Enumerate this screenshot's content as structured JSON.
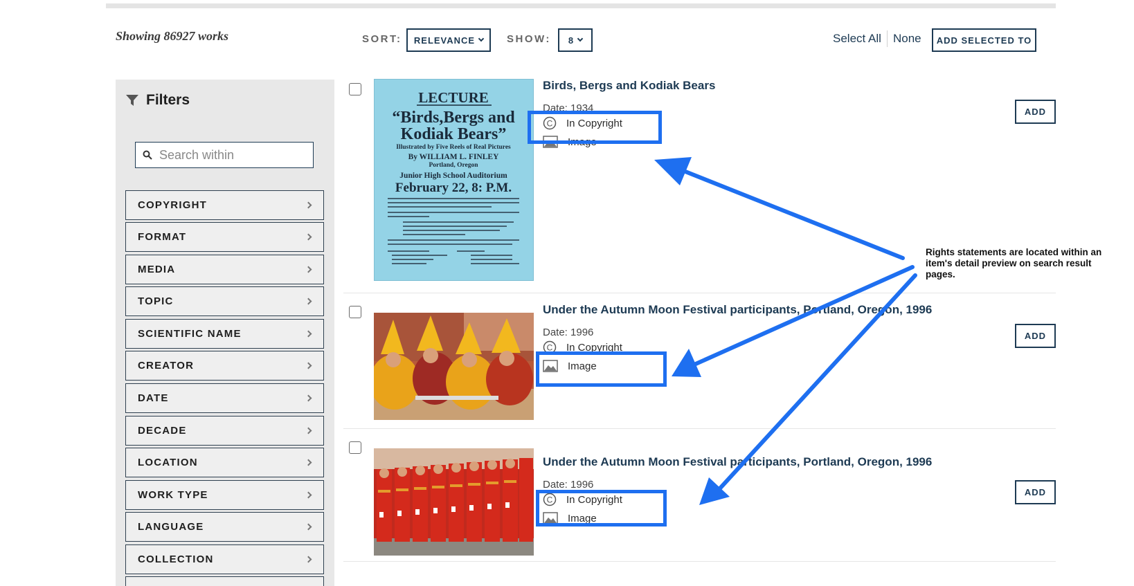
{
  "toolbar": {
    "results_count": "Showing 86927 works",
    "sort_label": "SORT:",
    "sort_value": "RELEVANCE",
    "show_label": "SHOW:",
    "show_value": "8",
    "select_all": "Select All",
    "none": "None",
    "add_selected": "ADD SELECTED TO"
  },
  "sidebar": {
    "title": "Filters",
    "search_placeholder": "Search within",
    "facets": [
      {
        "label": "COPYRIGHT"
      },
      {
        "label": "FORMAT"
      },
      {
        "label": "MEDIA"
      },
      {
        "label": "TOPIC"
      },
      {
        "label": "SCIENTIFIC NAME"
      },
      {
        "label": "CREATOR"
      },
      {
        "label": "DATE"
      },
      {
        "label": "DECADE"
      },
      {
        "label": "LOCATION"
      },
      {
        "label": "WORK TYPE"
      },
      {
        "label": "LANGUAGE"
      },
      {
        "label": "COLLECTION"
      }
    ]
  },
  "results": [
    {
      "title": "Birds, Bergs and Kodiak Bears",
      "date": "Date: 1934",
      "rights": "In Copyright",
      "format": "Image",
      "add_label": "ADD",
      "poster": {
        "heading": "LECTURE",
        "line1": "“Birds,Bergs and",
        "line2": "Kodiak Bears”",
        "line3": "Illustrated by Five Reels of Real Pictures",
        "line4": "By WILLIAM L. FINLEY",
        "line5": "Portland, Oregon",
        "line6": "Junior High School Auditorium",
        "line7": "February 22, 8: P.M."
      }
    },
    {
      "title": "Under the Autumn Moon Festival participants, Portland, Oregon, 1996",
      "date": "Date: 1996",
      "rights": "In Copyright",
      "format": "Image",
      "add_label": "ADD"
    },
    {
      "title": "Under the Autumn Moon Festival participants, Portland, Oregon, 1996",
      "date": "Date: 1996",
      "rights": "In Copyright",
      "format": "Image",
      "add_label": "ADD"
    }
  ],
  "annotation": {
    "text": "Rights statements are located within an item's detail preview on search result pages.",
    "color": "#1e6ff0"
  },
  "colors": {
    "primary": "#1d3a53",
    "sidebar_bg": "#e8e8e8",
    "highlight": "#1e6ff0"
  }
}
